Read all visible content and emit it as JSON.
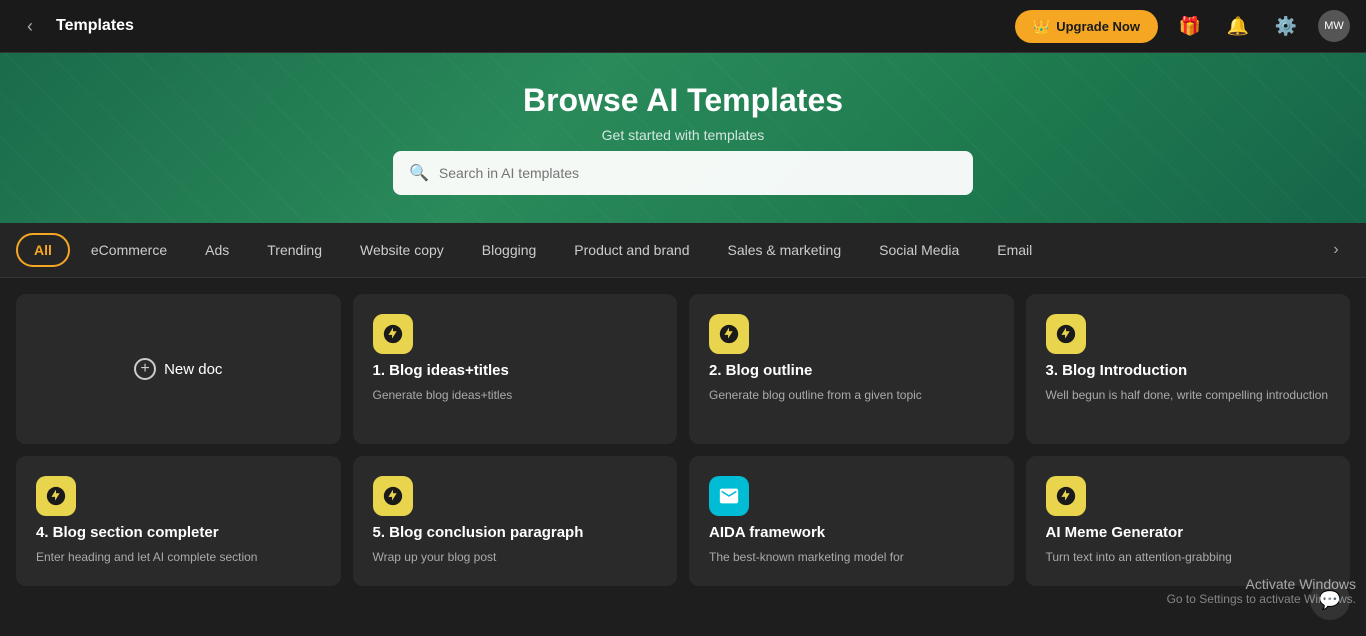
{
  "header": {
    "title": "Templates",
    "upgrade_label": "Upgrade Now",
    "back_label": "←",
    "avatar_label": "MW"
  },
  "hero": {
    "title": "Browse AI Templates",
    "subtitle": "Get started with templates",
    "search_placeholder": "Search in AI templates"
  },
  "filters": {
    "tabs": [
      {
        "id": "all",
        "label": "All",
        "active": true
      },
      {
        "id": "ecommerce",
        "label": "eCommerce",
        "active": false
      },
      {
        "id": "ads",
        "label": "Ads",
        "active": false
      },
      {
        "id": "trending",
        "label": "Trending",
        "active": false
      },
      {
        "id": "website-copy",
        "label": "Website copy",
        "active": false
      },
      {
        "id": "blogging",
        "label": "Blogging",
        "active": false
      },
      {
        "id": "product-brand",
        "label": "Product and brand",
        "active": false
      },
      {
        "id": "sales-marketing",
        "label": "Sales & marketing",
        "active": false
      },
      {
        "id": "social-media",
        "label": "Social Media",
        "active": false
      },
      {
        "id": "email",
        "label": "Email",
        "active": false
      }
    ]
  },
  "cards": {
    "new_doc_label": "New doc",
    "items": [
      {
        "id": 1,
        "icon_type": "yellow",
        "title": "1. Blog ideas+titles",
        "desc": "Generate blog ideas+titles"
      },
      {
        "id": 2,
        "icon_type": "yellow",
        "title": "2. Blog outline",
        "desc": "Generate blog outline from a given topic"
      },
      {
        "id": 3,
        "icon_type": "yellow",
        "title": "3. Blog Introduction",
        "desc": "Well begun is half done, write compelling introduction"
      },
      {
        "id": 4,
        "icon_type": "yellow",
        "title": "4. Blog section completer",
        "desc": "Enter heading and let AI complete section"
      },
      {
        "id": 5,
        "icon_type": "yellow",
        "title": "5. Blog conclusion paragraph",
        "desc": "Wrap up your blog post"
      },
      {
        "id": 6,
        "icon_type": "cyan",
        "title": "AIDA framework",
        "desc": "The best-known marketing model for"
      },
      {
        "id": 7,
        "icon_type": "yellow",
        "title": "AI Meme Generator",
        "desc": "Turn text into an attention-grabbing"
      }
    ],
    "activate_line1": "Activate Windows",
    "activate_line2": "Go to Settings to activate Windows."
  }
}
